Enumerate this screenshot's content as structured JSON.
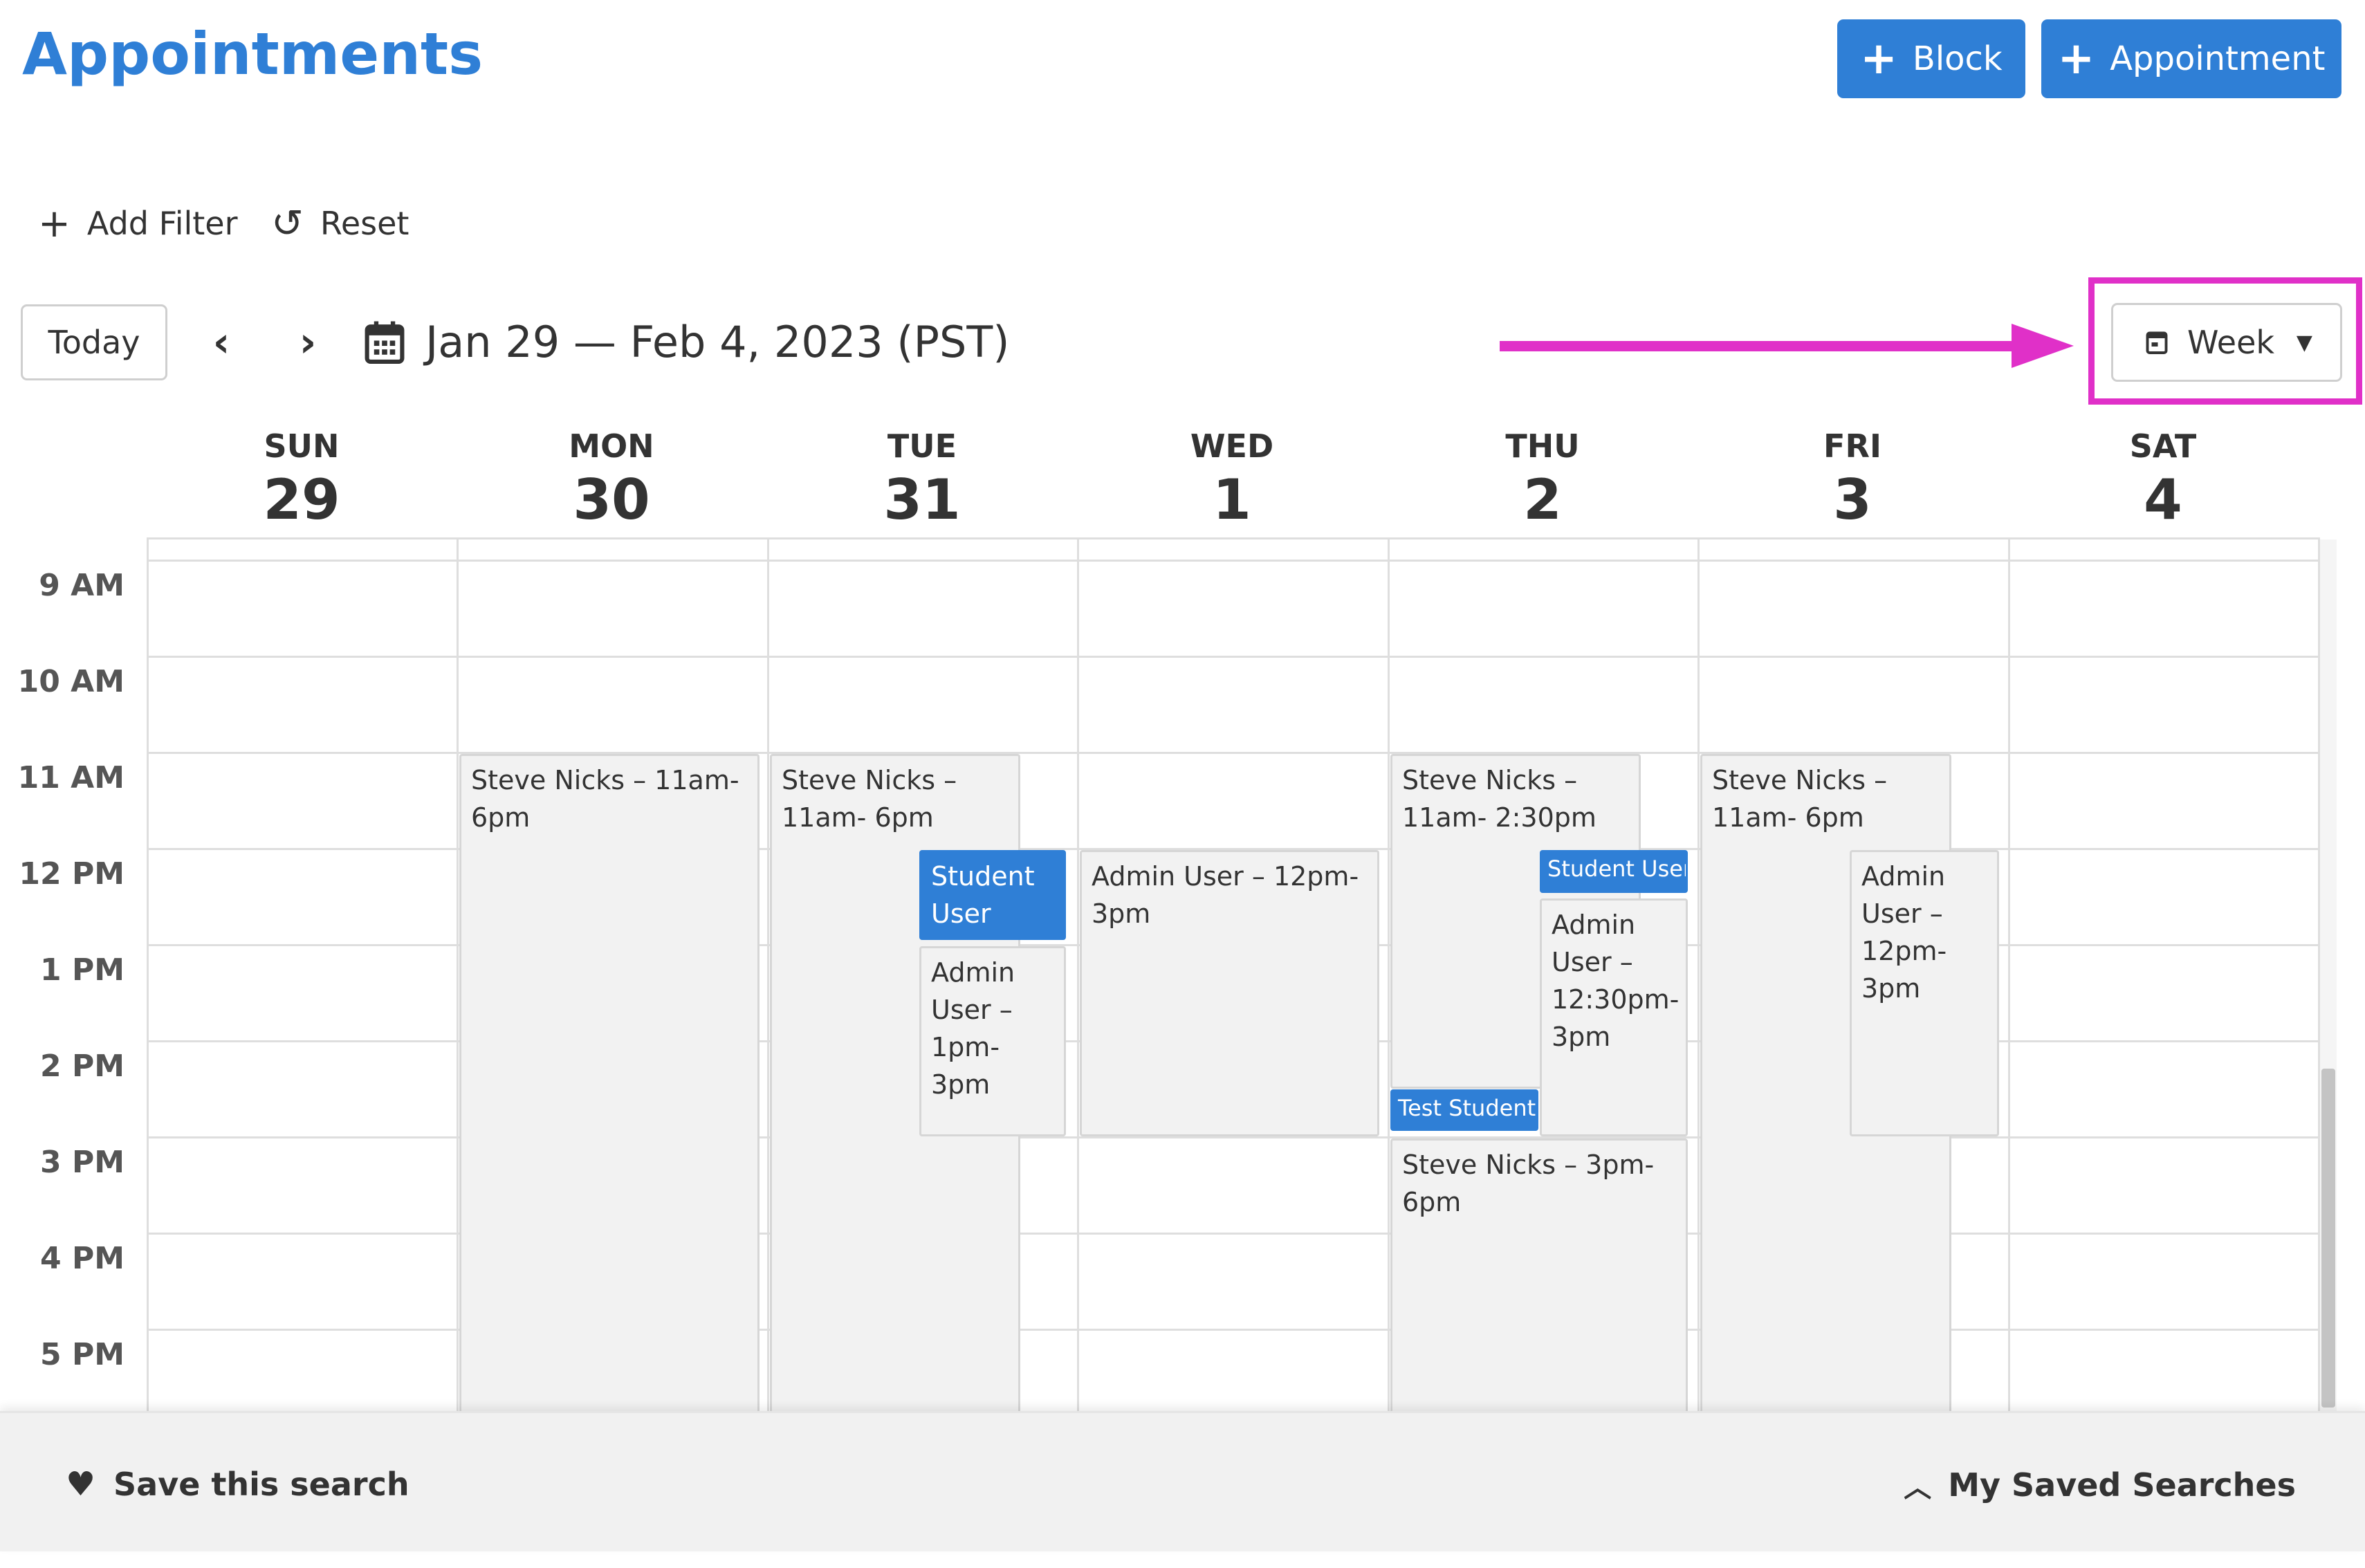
{
  "header": {
    "title": "Appointments",
    "block_label": "Block",
    "appointment_label": "Appointment"
  },
  "filters": {
    "add_filter": "Add Filter",
    "reset": "Reset"
  },
  "toolbar": {
    "today": "Today",
    "date_range": "Jan 29 — Feb 4, 2023 (PST)",
    "view": "Week"
  },
  "days": [
    {
      "name": "SUN",
      "date": "29"
    },
    {
      "name": "MON",
      "date": "30"
    },
    {
      "name": "TUE",
      "date": "31"
    },
    {
      "name": "WED",
      "date": "1"
    },
    {
      "name": "THU",
      "date": "2"
    },
    {
      "name": "FRI",
      "date": "3"
    },
    {
      "name": "SAT",
      "date": "4"
    }
  ],
  "times": [
    "9 AM",
    "10 AM",
    "11 AM",
    "12 PM",
    "1 PM",
    "2 PM",
    "3 PM",
    "4 PM",
    "5 PM"
  ],
  "events": {
    "mon_steve": "Steve Nicks – 11am- 6pm",
    "tue_steve": "Steve Nicks – 11am- 6pm",
    "tue_student": "Student User",
    "tue_admin": "Admin User – 1pm- 3pm",
    "wed_admin": "Admin User – 12pm- 3pm",
    "thu_steve1": "Steve Nicks – 11am- 2:30pm",
    "thu_student": "Student User",
    "thu_admin": "Admin User – 12:30pm- 3pm",
    "thu_test": "Test Student (",
    "thu_steve2": "Steve Nicks – 3pm- 6pm",
    "fri_steve": "Steve Nicks – 11am- 6pm",
    "fri_admin": "Admin User – 12pm- 3pm"
  },
  "footer": {
    "save_search": "Save this search",
    "my_saved_searches": "My Saved Searches"
  },
  "colors": {
    "accent": "#2f7fd6",
    "highlight": "#e030c8"
  }
}
